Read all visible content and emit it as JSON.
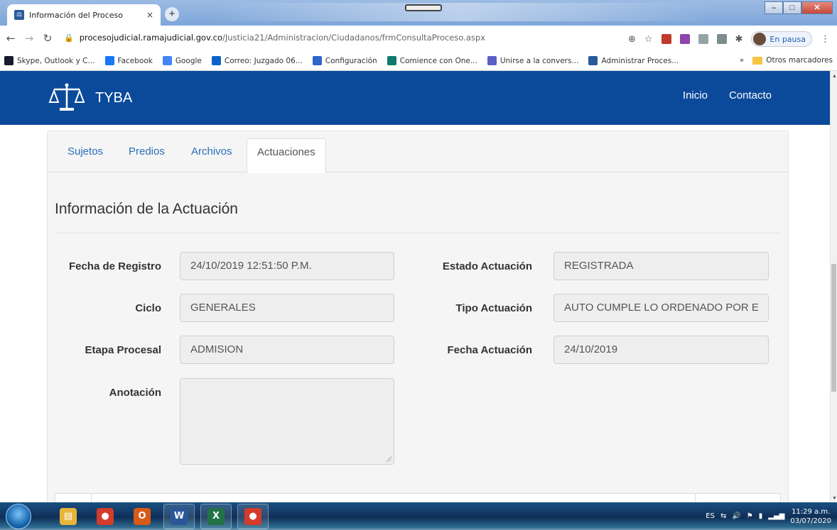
{
  "browser": {
    "tab_title": "Información del Proceso",
    "tab_close": "×",
    "new_tab": "+",
    "url_host": "procesojudicial.ramajudicial.gov.co",
    "url_path": "/Justicia21/Administracion/Ciudadanos/frmConsultaProceso.aspx",
    "profile_label": "En pausa",
    "bookmarks": [
      {
        "label": "Skype, Outlook y C...",
        "icon": "skype-icon",
        "color": "#1a1a2e"
      },
      {
        "label": "Facebook",
        "icon": "facebook-icon",
        "color": "#1877f2"
      },
      {
        "label": "Google",
        "icon": "google-icon",
        "color": "#4285f4"
      },
      {
        "label": "Correo: Juzgado 06...",
        "icon": "outlook-icon",
        "color": "#0a64c8"
      },
      {
        "label": "Configuración",
        "icon": "gear-icon",
        "color": "#2b66c8"
      },
      {
        "label": "Comience con One...",
        "icon": "sharepoint-icon",
        "color": "#0f7b6c"
      },
      {
        "label": "Unirse a la convers...",
        "icon": "teams-icon",
        "color": "#5b5fc7"
      },
      {
        "label": "Administrar Proces...",
        "icon": "tyba-icon",
        "color": "#2a5a9a"
      }
    ],
    "bookmarks_more": "»",
    "other_bookmarks": "Otros marcadores"
  },
  "app": {
    "brand": "TYBA",
    "nav": {
      "home": "Inicio",
      "contact": "Contacto"
    }
  },
  "tabs": {
    "subjects": "Sujetos",
    "properties": "Predios",
    "files": "Archivos",
    "actions": "Actuaciones"
  },
  "section": {
    "title": "Información de la Actuación"
  },
  "fields": {
    "fecha_registro": {
      "label": "Fecha de Registro",
      "value": "24/10/2019 12:51:50 P.M."
    },
    "estado_actuacion": {
      "label": "Estado Actuación",
      "value": "REGISTRADA"
    },
    "ciclo": {
      "label": "Ciclo",
      "value": "GENERALES"
    },
    "tipo_actuacion": {
      "label": "Tipo Actuación",
      "value": "AUTO CUMPLE LO ORDENADO POR E"
    },
    "etapa_procesal": {
      "label": "Etapa Procesal",
      "value": "ADMISION"
    },
    "fecha_actuacion": {
      "label": "Fecha Actuación",
      "value": "24/10/2019"
    },
    "anotacion": {
      "label": "Anotación",
      "value": ""
    }
  },
  "taskbar": {
    "language": "ES",
    "time": "11:29 a.m.",
    "date": "03/07/2020",
    "apps": [
      {
        "name": "explorer-icon",
        "color": "#e8b53a"
      },
      {
        "name": "chrome-icon",
        "color": "#d33b2c"
      },
      {
        "name": "outlook-icon",
        "color": "#d85a17"
      },
      {
        "name": "word-icon",
        "color": "#2b579a"
      },
      {
        "name": "excel-icon",
        "color": "#217346"
      },
      {
        "name": "chrome-profile-icon",
        "color": "#d33b2c"
      }
    ]
  }
}
